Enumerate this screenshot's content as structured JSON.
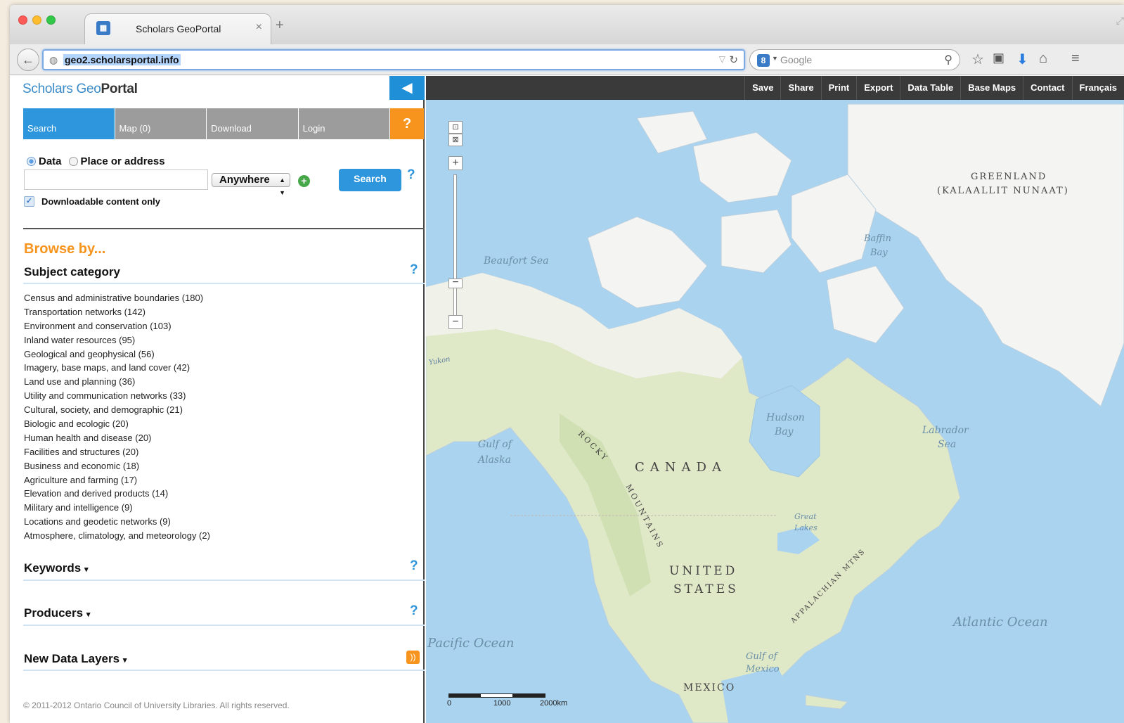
{
  "browser": {
    "tab_title": "Scholars GeoPortal",
    "tab_close": "×",
    "new_tab": "+",
    "url": "geo2.scholarsportal.info",
    "search_placeholder": "Google",
    "search_engine_icon": "google-icon"
  },
  "sidebar": {
    "logo_prefix": "Scholars Geo",
    "logo_bold": "Portal",
    "collapse": "◀",
    "nav": [
      {
        "label": "Search",
        "active": true
      },
      {
        "label": "Map (0)"
      },
      {
        "label": "Download"
      },
      {
        "label": "Login"
      }
    ],
    "nav_help": "?",
    "radio_data": "Data",
    "radio_place": "Place or address",
    "search_value": "",
    "scope_value": "Anywhere",
    "search_button": "Search",
    "help": "?",
    "downloadable_only": "Downloadable content only",
    "browse_title": "Browse by...",
    "subject_category": "Subject category",
    "categories": [
      "Census and administrative boundaries (180)",
      "Transportation networks (142)",
      "Environment and conservation (103)",
      "Inland water resources (95)",
      "Geological and geophysical (56)",
      "Imagery, base maps, and land cover (42)",
      "Land use and planning (36)",
      "Utility and communication networks (33)",
      "Cultural, society, and demographic (21)",
      "Biologic and ecologic (20)",
      "Human health and disease (20)",
      "Facilities and structures (20)",
      "Business and economic (18)",
      "Agriculture and farming (17)",
      "Elevation and derived products (14)",
      "Military and intelligence (9)",
      "Locations and geodetic networks (9)",
      "Atmosphere, climatology, and meteorology (2)"
    ],
    "keywords": "Keywords",
    "producers": "Producers",
    "new_data_layers": "New Data Layers",
    "footer": "© 2011-2012 Ontario Council of University Libraries. All rights reserved."
  },
  "map": {
    "toolbar": [
      "Save",
      "Share",
      "Print",
      "Export",
      "Data Table",
      "Base Maps",
      "Contact",
      "Français"
    ],
    "labels": {
      "greenland_1": "GREENLAND",
      "greenland_2": "(KALAALLIT NUNAAT)",
      "baffin_1": "Baffin",
      "baffin_2": "Bay",
      "beaufort": "Beaufort Sea",
      "hudson_1": "Hudson",
      "hudson_2": "Bay",
      "labrador_1": "Labrador",
      "labrador_2": "Sea",
      "alaska_1": "Gulf of",
      "alaska_2": "Alaska",
      "canada": "CANADA",
      "rocky": "ROCKY",
      "mountains": "MOUNTAINS",
      "great_1": "Great",
      "great_2": "Lakes",
      "us_1": "UNITED",
      "us_2": "STATES",
      "appalachian": "APPALACHIAN MTNS",
      "atlantic": "Atlantic Ocean",
      "pacific": "Pacific Ocean",
      "mexico_gulf_1": "Gulf of",
      "mexico_gulf_2": "Mexico",
      "mexico": "MEXICO",
      "yukon": "Yukon"
    },
    "scale": [
      "0",
      "1000",
      "2000km"
    ]
  },
  "colors": {
    "accent_blue": "#2e96dd",
    "accent_orange": "#f7941d",
    "water": "#aad3ef",
    "land": "#dfe9c8"
  }
}
